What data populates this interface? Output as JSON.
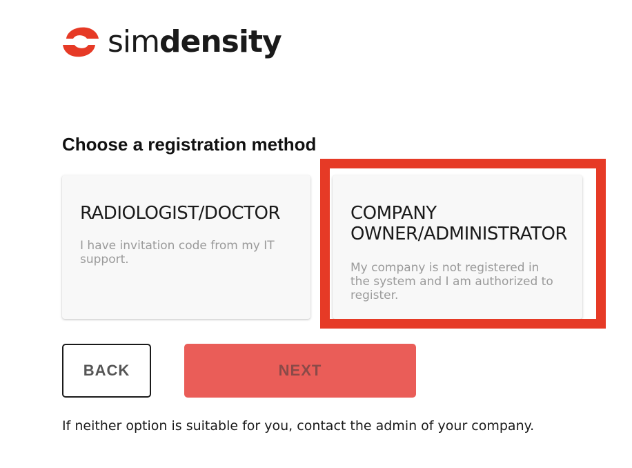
{
  "brand": {
    "name_light": "sim",
    "name_bold": "density",
    "accent_color": "#e63a26"
  },
  "heading": "Choose a registration method",
  "options": [
    {
      "title": "RADIOLOGIST/DOCTOR",
      "description": "I have invitation code from my IT support."
    },
    {
      "title_line1": "COMPANY",
      "title_line2": "OWNER/ADMINISTRATOR",
      "description_line1": "My company is not registered in",
      "description_line2": "the system and I am authorized to",
      "description_line3": "register.",
      "highlighted": true
    }
  ],
  "buttons": {
    "back_label": "BACK",
    "next_label": "NEXT",
    "next_color": "#ea5d58"
  },
  "footer_note": "If neither option is suitable for you, contact the admin of your company."
}
